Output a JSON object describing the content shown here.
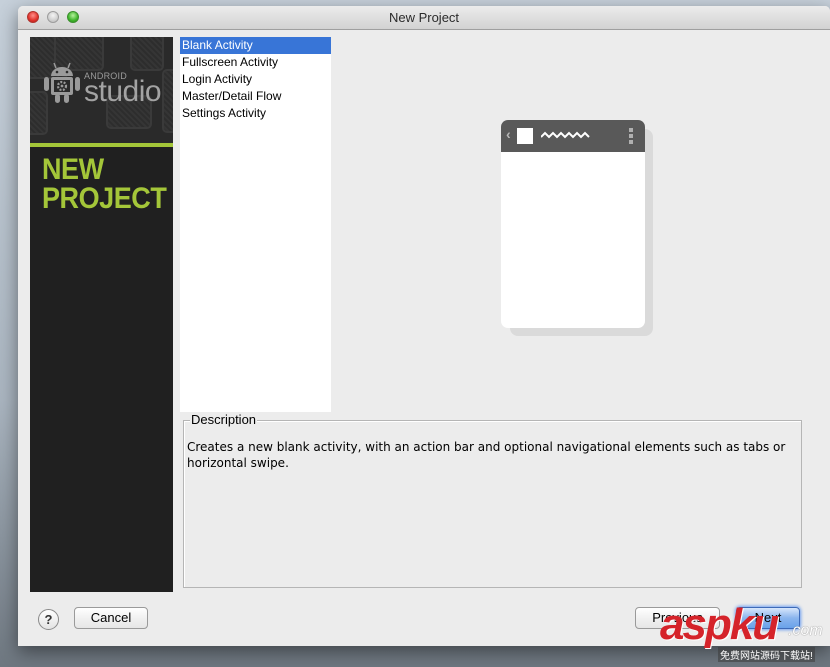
{
  "window": {
    "title": "New Project",
    "controls": [
      "close",
      "minimize",
      "zoom"
    ]
  },
  "sidebar": {
    "brand_small": "ANDROID",
    "brand_large": "studio",
    "heading_line1": "NEW",
    "heading_line2": "PROJECT",
    "accent_color": "#a4c639"
  },
  "activity_list": {
    "selected_index": 0,
    "items": [
      {
        "label": "Blank Activity"
      },
      {
        "label": "Fullscreen Activity"
      },
      {
        "label": "Login Activity"
      },
      {
        "label": "Master/Detail Flow"
      },
      {
        "label": "Settings Activity"
      }
    ]
  },
  "preview": {
    "icons": [
      "back-chevron-icon",
      "app-icon",
      "title-placeholder-icon",
      "overflow-menu-icon"
    ]
  },
  "description": {
    "legend": "Description",
    "text": "Creates a new blank activity, with an action bar and optional navigational elements such as tabs or horizontal swipe."
  },
  "footer": {
    "help_label": "?",
    "cancel_label": "Cancel",
    "previous_label": "Previous",
    "next_label": "Next"
  },
  "watermark": {
    "main": "aspku",
    "suffix": ".com",
    "tagline": "免费网站源码下载站!"
  }
}
